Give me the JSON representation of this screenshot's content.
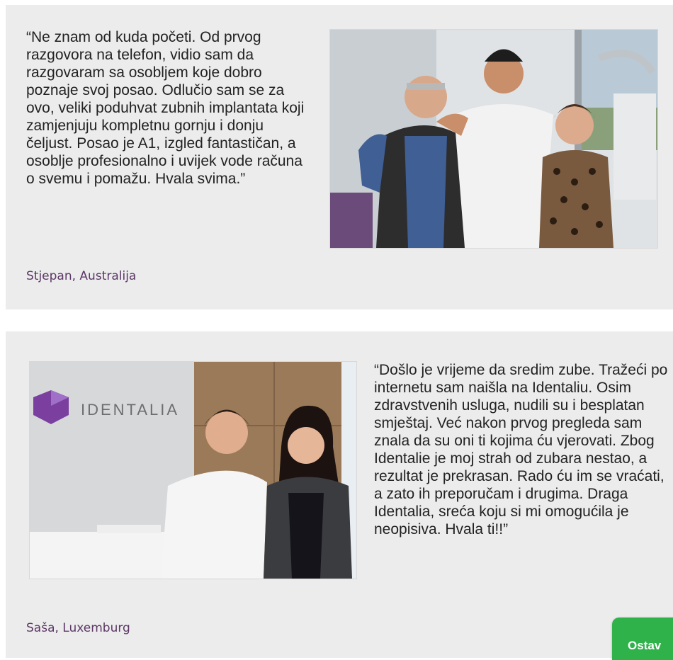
{
  "testimonials": [
    {
      "quote": "“Ne znam od kuda početi. Od prvog razgovora na telefon, vidio sam da razgovaram sa osobljem koje dobro poznaje svoj posao. Odlučio sam se za ovo, veliki poduhvat zubnih implantata koji zamjenjuju kompletnu gornju i donju čeljust. Posao je A1, izgled fantastičan, a osoblje profesionalno i uvijek vode računa o svemu i pomažu. Hvala svima.”",
      "author": "Stjepan, Australija"
    },
    {
      "quote": "“Došlo je vrijeme da sredim zube. Tražeći po internetu sam naišla na Identaliu. Osim zdravstvenih usluga, nudili su i besplatan smještaj. Već nakon prvog pregleda sam znala da su oni ti kojima ću vjerovati. Zbog Identalie je moj strah od zubara nestao, a rezultat je prekrasan. Rado ću im se vraćati, a zato ih preporučam i drugima. Draga Identalia, sreća koju si mi omogućila je neopisiva. Hvala ti!!”",
      "author": "Saša, Luxemburg",
      "wall_logo_text": "IDENTALIA"
    }
  ],
  "cta": {
    "label": "Ostav"
  },
  "colors": {
    "card_bg": "#ececec",
    "author_purple": "#5c3766",
    "cta_green": "#2fb24a",
    "logo_purple": "#7b3fa0"
  }
}
